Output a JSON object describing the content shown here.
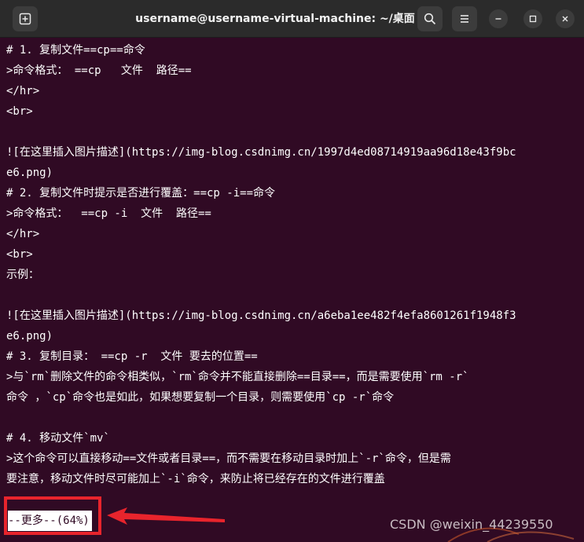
{
  "window": {
    "title": "username@username-virtual-machine: ~/桌面"
  },
  "titlebar": {
    "new_tab_icon": "new-tab-icon",
    "search_icon": "search-icon",
    "menu_icon": "hamburger-menu-icon",
    "minimize_icon": "minimize-icon",
    "maximize_icon": "maximize-icon",
    "close_icon": "close-icon"
  },
  "terminal": {
    "lines": [
      "# 1. 复制文件==cp==命令",
      ">命令格式： ==cp   文件  路径==",
      "</hr>",
      "<br>",
      "",
      "![在这里插入图片描述](https://img-blog.csdnimg.cn/1997d4ed08714919aa96d18e43f9bc",
      "e6.png)",
      "# 2. 复制文件时提示是否进行覆盖：==cp -i==命令",
      ">命令格式：  ==cp -i  文件  路径==",
      "</hr>",
      "<br>",
      "示例：",
      "",
      "![在这里插入图片描述](https://img-blog.csdnimg.cn/a6eba1ee482f4efa8601261f1948f3",
      "e6.png)",
      "# 3. 复制目录： ==cp -r  文件 要去的位置==",
      ">与`rm`删除文件的命令相类似，`rm`命令并不能直接删除==目录==，而是需要使用`rm -r`",
      "命令 ，`cp`命令也是如此，如果想要复制一个目录，则需要使用`cp -r`命令",
      "",
      "# 4. 移动文件`mv`",
      ">这个命令可以直接移动==文件或者目录==，而不需要在移动目录时加上`-r`命令，但是需",
      "要注意，移动文件时尽可能加上`-i`命令，来防止将已经存在的文件进行覆盖",
      ""
    ],
    "pager_prompt": "--更多--(64%)"
  },
  "annotation": {
    "highlight_color": "#e8242c"
  },
  "watermark": {
    "text": "CSDN @weixin_44239550"
  },
  "colors": {
    "terminal_bg": "#300a24",
    "titlebar_bg": "#2b2b2b",
    "text": "#ffffff"
  }
}
